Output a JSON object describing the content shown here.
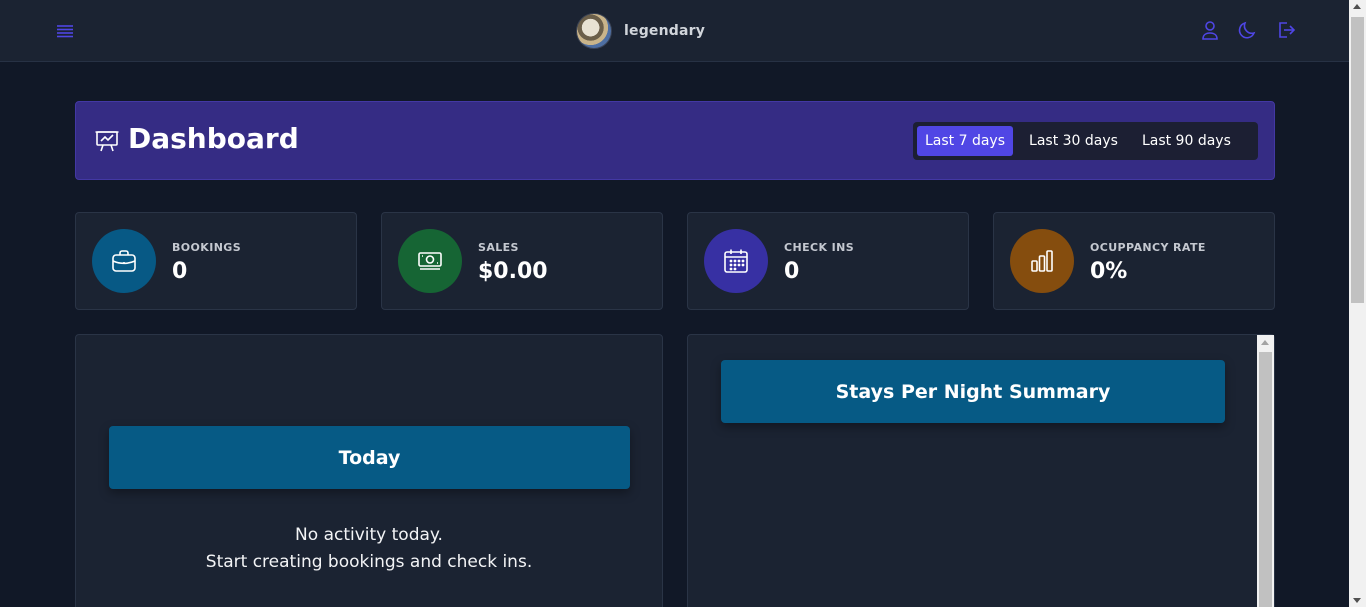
{
  "header": {
    "username": "legendary",
    "icons": [
      "menu-icon",
      "user-icon",
      "moon-icon",
      "logout-icon"
    ]
  },
  "dashboard": {
    "title": "Dashboard",
    "ranges": [
      {
        "label": "Last 7 days",
        "active": true
      },
      {
        "label": "Last 30 days",
        "active": false
      },
      {
        "label": "Last 90 days",
        "active": false
      }
    ]
  },
  "stats": [
    {
      "label": "BOOKINGS",
      "value": "0",
      "icon": "briefcase-icon",
      "color": "#075985"
    },
    {
      "label": "SALES",
      "value": "$0.00",
      "icon": "money-icon",
      "color": "#166534"
    },
    {
      "label": "CHECK INS",
      "value": "0",
      "icon": "calendar-icon",
      "color": "#3730a3"
    },
    {
      "label": "OCUPPANCY RATE",
      "value": "0%",
      "icon": "bar-chart-icon",
      "color": "#854d0e"
    }
  ],
  "today": {
    "title": "Today",
    "empty_line1": "No activity today.",
    "empty_line2": "Start creating bookings and check ins."
  },
  "stays": {
    "title": "Stays Per Night Summary"
  },
  "colors": {
    "accent": "#5046e5",
    "header_bg": "#352c84",
    "banner": "#065a85",
    "page_bg": "#111827",
    "card_bg": "#1b2332"
  }
}
